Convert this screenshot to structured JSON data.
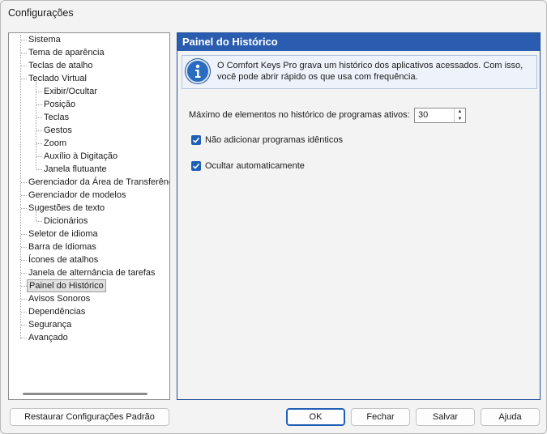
{
  "window": {
    "title": "Configurações"
  },
  "tree": {
    "items": [
      {
        "label": "Sistema",
        "level": 0
      },
      {
        "label": "Tema de aparência",
        "level": 0
      },
      {
        "label": "Teclas de atalho",
        "level": 0
      },
      {
        "label": "Teclado Virtual",
        "level": 0
      },
      {
        "label": "Exibir/Ocultar",
        "level": 1
      },
      {
        "label": "Posição",
        "level": 1
      },
      {
        "label": "Teclas",
        "level": 1
      },
      {
        "label": "Gestos",
        "level": 1
      },
      {
        "label": "Zoom",
        "level": 1
      },
      {
        "label": "Auxílio à Digitação",
        "level": 1
      },
      {
        "label": "Janela flutuante",
        "level": 1
      },
      {
        "label": "Gerenciador da Área de Transferência",
        "level": 0
      },
      {
        "label": "Gerenciador de modelos",
        "level": 0
      },
      {
        "label": "Sugestões de texto",
        "level": 0
      },
      {
        "label": "Dicionários",
        "level": 1
      },
      {
        "label": "Seletor de idioma",
        "level": 0
      },
      {
        "label": "Barra de Idiomas",
        "level": 0
      },
      {
        "label": "Ícones de atalhos",
        "level": 0
      },
      {
        "label": "Janela de alternância de tarefas",
        "level": 0
      },
      {
        "label": "Painel do Histórico",
        "level": 0,
        "selected": true
      },
      {
        "label": "Avisos Sonoros",
        "level": 0
      },
      {
        "label": "Dependências",
        "level": 0
      },
      {
        "label": "Segurança",
        "level": 0
      },
      {
        "label": "Avançado",
        "level": 0
      }
    ]
  },
  "panel": {
    "title": "Painel do Histórico",
    "info_icon": "info-icon",
    "info_text": "O Comfort Keys Pro grava um histórico dos aplicativos acessados. Com isso, você pode abrir rápido os que usa com frequência.",
    "max_label": "Máximo de elementos no histórico de programas ativos:",
    "max_value": "30",
    "check1_label": "Não adicionar programas idênticos",
    "check1_checked": true,
    "check2_label": "Ocultar automaticamente",
    "check2_checked": true
  },
  "buttons": {
    "restore": "Restaurar Configurações Padrão",
    "ok": "OK",
    "close": "Fechar",
    "save": "Salvar",
    "help": "Ajuda"
  },
  "colors": {
    "accent": "#2a5db0",
    "checkbox": "#1f5fb5"
  }
}
